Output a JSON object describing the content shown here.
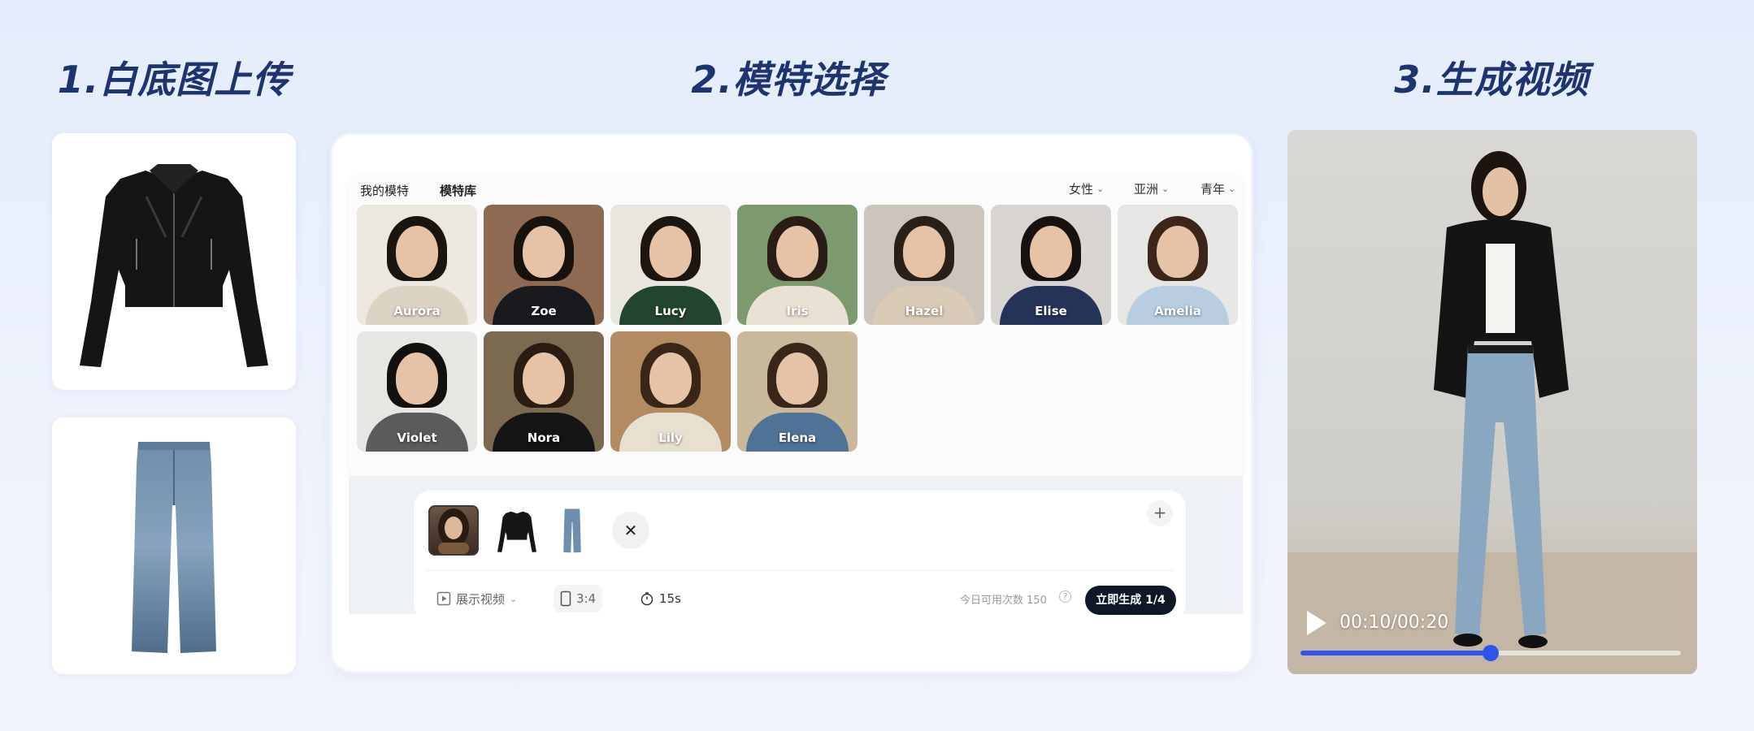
{
  "steps": {
    "upload_title": "1.白底图上传",
    "model_title": "2.模特选择",
    "video_title": "3.生成视频"
  },
  "garments": [
    {
      "name": "jacket",
      "icon": "leather-jacket-icon"
    },
    {
      "name": "jeans",
      "icon": "flare-jeans-icon"
    }
  ],
  "picker": {
    "tabs": [
      "我的模特",
      "模特库"
    ],
    "active_tab": "模特库",
    "filters": {
      "gender": "女性",
      "region": "亚洲",
      "age": "青年"
    }
  },
  "models": [
    {
      "name": "Aurora",
      "bg": "#ece7df",
      "outfit": "#ddd3c4",
      "hair": "#1b1511"
    },
    {
      "name": "Zoe",
      "bg": "#8e6a52",
      "outfit": "#1a1a1e",
      "hair": "#18120e"
    },
    {
      "name": "Lucy",
      "bg": "#e9e6e0",
      "outfit": "#22452f",
      "hair": "#1c1510"
    },
    {
      "name": "Iris",
      "bg": "#7c9a6e",
      "outfit": "#e9e1d3",
      "hair": "#2a1d15"
    },
    {
      "name": "Hazel",
      "bg": "#cbc5bc",
      "outfit": "#d9cbb5",
      "hair": "#2b2018"
    },
    {
      "name": "Elise",
      "bg": "#d8d4cf",
      "outfit": "#263358",
      "hair": "#17120f"
    },
    {
      "name": "Amelia",
      "bg": "#e6e6e4",
      "outfit": "#b9cde0",
      "hair": "#3b2619"
    },
    {
      "name": "Violet",
      "bg": "#e8e6e3",
      "outfit": "#5b5b5d",
      "hair": "#131110"
    },
    {
      "name": "Nora",
      "bg": "#7b6a4f",
      "outfit": "#151515",
      "hair": "#2a1c13"
    },
    {
      "name": "Lily",
      "bg": "#b38b62",
      "outfit": "#e7dfd0",
      "hair": "#3a2618"
    },
    {
      "name": "Elena",
      "bg": "#c9b89a",
      "outfit": "#4f7396",
      "hair": "#3a2619"
    }
  ],
  "composer": {
    "close_icon": "close-icon",
    "add_icon": "plus-icon",
    "show_video_label": "展示视频",
    "ratio_label": "3:4",
    "duration_label": "15s",
    "quota_label": "今日可用次数 150",
    "help_icon": "?",
    "generate_label": "立即生成 1/4"
  },
  "video": {
    "time_text": "00:10/00:20",
    "progress": 0.5,
    "accent": "#2f54eb"
  }
}
